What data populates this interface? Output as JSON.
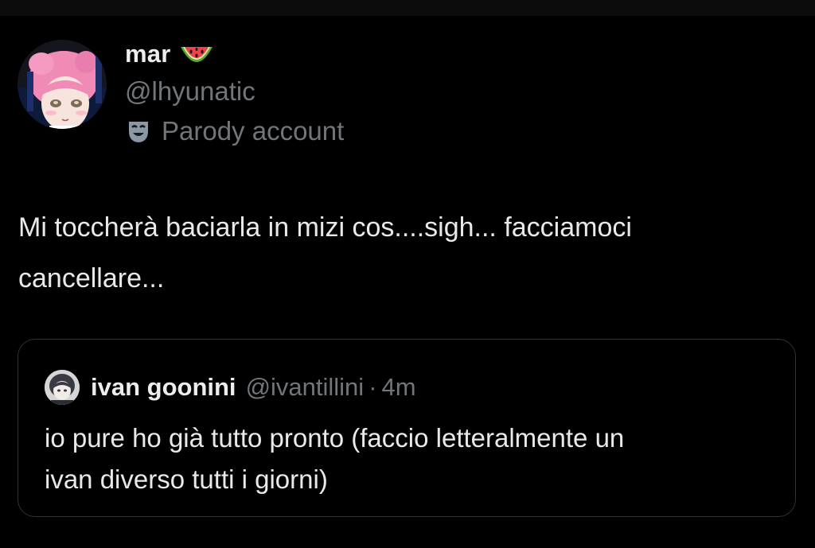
{
  "author": {
    "display_name": "mar",
    "name_emoji": "watermelon-emoji",
    "handle": "@lhyunatic",
    "parody_label": "Parody account",
    "parody_icon": "theater-mask-icon"
  },
  "tweet": {
    "text_lines": [
      "Mi toccherà baciarla in mizi cos....sigh... facciamoci",
      "cancellare..."
    ]
  },
  "quoted_tweet": {
    "display_name": "ivan goonini",
    "handle": "@ivantillini",
    "separator": "·",
    "time": "4m",
    "text_lines": [
      "io pure ho già tutto pronto (faccio letteralmente un",
      "ivan diverso tutti i giorni)"
    ]
  },
  "colors": {
    "background": "#000000",
    "primary_text": "#e7e9ea",
    "secondary_text": "#71767b",
    "card_border": "#2f3336"
  }
}
